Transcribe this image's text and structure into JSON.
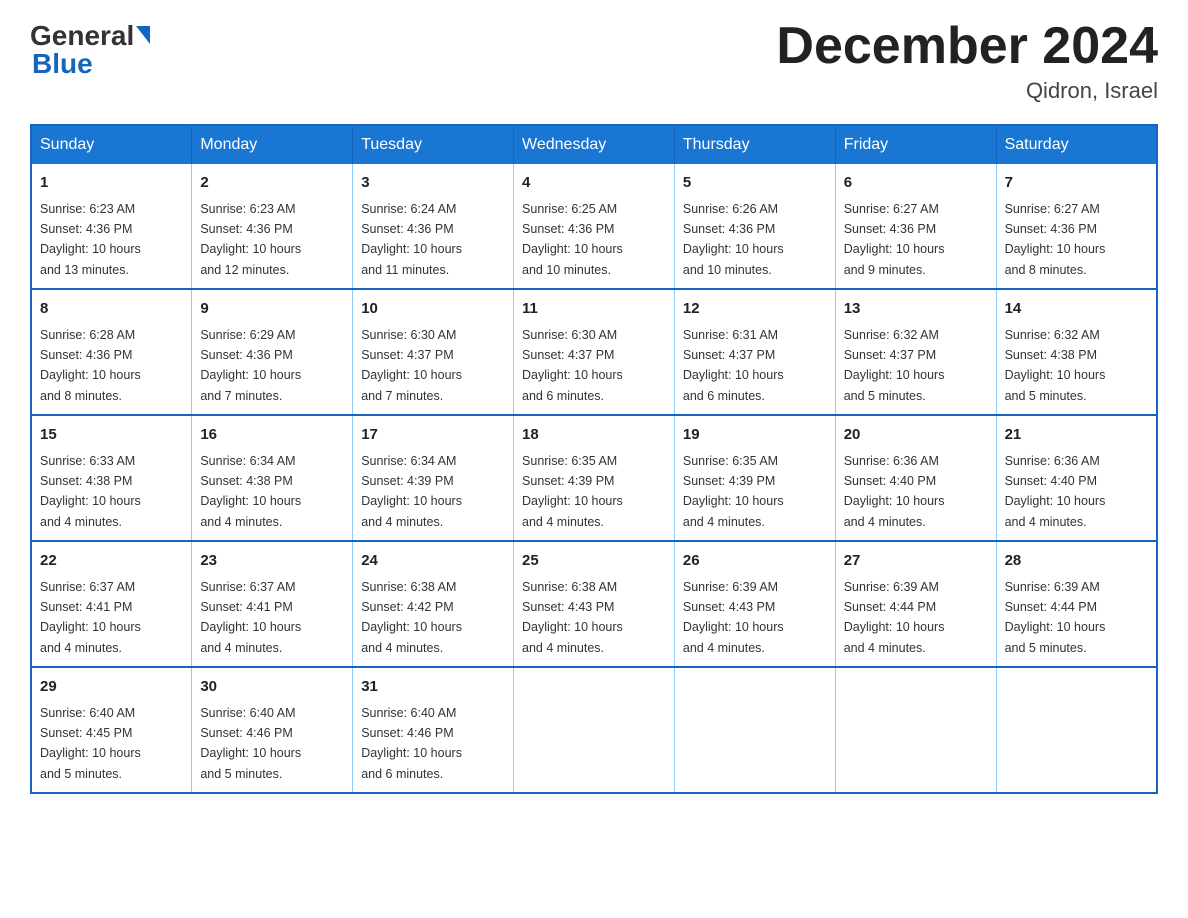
{
  "header": {
    "logo_general": "General",
    "logo_blue": "Blue",
    "month_title": "December 2024",
    "location": "Qidron, Israel"
  },
  "days_of_week": [
    "Sunday",
    "Monday",
    "Tuesday",
    "Wednesday",
    "Thursday",
    "Friday",
    "Saturday"
  ],
  "weeks": [
    [
      {
        "day": "1",
        "sunrise": "6:23 AM",
        "sunset": "4:36 PM",
        "daylight": "10 hours and 13 minutes."
      },
      {
        "day": "2",
        "sunrise": "6:23 AM",
        "sunset": "4:36 PM",
        "daylight": "10 hours and 12 minutes."
      },
      {
        "day": "3",
        "sunrise": "6:24 AM",
        "sunset": "4:36 PM",
        "daylight": "10 hours and 11 minutes."
      },
      {
        "day": "4",
        "sunrise": "6:25 AM",
        "sunset": "4:36 PM",
        "daylight": "10 hours and 10 minutes."
      },
      {
        "day": "5",
        "sunrise": "6:26 AM",
        "sunset": "4:36 PM",
        "daylight": "10 hours and 10 minutes."
      },
      {
        "day": "6",
        "sunrise": "6:27 AM",
        "sunset": "4:36 PM",
        "daylight": "10 hours and 9 minutes."
      },
      {
        "day": "7",
        "sunrise": "6:27 AM",
        "sunset": "4:36 PM",
        "daylight": "10 hours and 8 minutes."
      }
    ],
    [
      {
        "day": "8",
        "sunrise": "6:28 AM",
        "sunset": "4:36 PM",
        "daylight": "10 hours and 8 minutes."
      },
      {
        "day": "9",
        "sunrise": "6:29 AM",
        "sunset": "4:36 PM",
        "daylight": "10 hours and 7 minutes."
      },
      {
        "day": "10",
        "sunrise": "6:30 AM",
        "sunset": "4:37 PM",
        "daylight": "10 hours and 7 minutes."
      },
      {
        "day": "11",
        "sunrise": "6:30 AM",
        "sunset": "4:37 PM",
        "daylight": "10 hours and 6 minutes."
      },
      {
        "day": "12",
        "sunrise": "6:31 AM",
        "sunset": "4:37 PM",
        "daylight": "10 hours and 6 minutes."
      },
      {
        "day": "13",
        "sunrise": "6:32 AM",
        "sunset": "4:37 PM",
        "daylight": "10 hours and 5 minutes."
      },
      {
        "day": "14",
        "sunrise": "6:32 AM",
        "sunset": "4:38 PM",
        "daylight": "10 hours and 5 minutes."
      }
    ],
    [
      {
        "day": "15",
        "sunrise": "6:33 AM",
        "sunset": "4:38 PM",
        "daylight": "10 hours and 4 minutes."
      },
      {
        "day": "16",
        "sunrise": "6:34 AM",
        "sunset": "4:38 PM",
        "daylight": "10 hours and 4 minutes."
      },
      {
        "day": "17",
        "sunrise": "6:34 AM",
        "sunset": "4:39 PM",
        "daylight": "10 hours and 4 minutes."
      },
      {
        "day": "18",
        "sunrise": "6:35 AM",
        "sunset": "4:39 PM",
        "daylight": "10 hours and 4 minutes."
      },
      {
        "day": "19",
        "sunrise": "6:35 AM",
        "sunset": "4:39 PM",
        "daylight": "10 hours and 4 minutes."
      },
      {
        "day": "20",
        "sunrise": "6:36 AM",
        "sunset": "4:40 PM",
        "daylight": "10 hours and 4 minutes."
      },
      {
        "day": "21",
        "sunrise": "6:36 AM",
        "sunset": "4:40 PM",
        "daylight": "10 hours and 4 minutes."
      }
    ],
    [
      {
        "day": "22",
        "sunrise": "6:37 AM",
        "sunset": "4:41 PM",
        "daylight": "10 hours and 4 minutes."
      },
      {
        "day": "23",
        "sunrise": "6:37 AM",
        "sunset": "4:41 PM",
        "daylight": "10 hours and 4 minutes."
      },
      {
        "day": "24",
        "sunrise": "6:38 AM",
        "sunset": "4:42 PM",
        "daylight": "10 hours and 4 minutes."
      },
      {
        "day": "25",
        "sunrise": "6:38 AM",
        "sunset": "4:43 PM",
        "daylight": "10 hours and 4 minutes."
      },
      {
        "day": "26",
        "sunrise": "6:39 AM",
        "sunset": "4:43 PM",
        "daylight": "10 hours and 4 minutes."
      },
      {
        "day": "27",
        "sunrise": "6:39 AM",
        "sunset": "4:44 PM",
        "daylight": "10 hours and 4 minutes."
      },
      {
        "day": "28",
        "sunrise": "6:39 AM",
        "sunset": "4:44 PM",
        "daylight": "10 hours and 5 minutes."
      }
    ],
    [
      {
        "day": "29",
        "sunrise": "6:40 AM",
        "sunset": "4:45 PM",
        "daylight": "10 hours and 5 minutes."
      },
      {
        "day": "30",
        "sunrise": "6:40 AM",
        "sunset": "4:46 PM",
        "daylight": "10 hours and 5 minutes."
      },
      {
        "day": "31",
        "sunrise": "6:40 AM",
        "sunset": "4:46 PM",
        "daylight": "10 hours and 6 minutes."
      },
      null,
      null,
      null,
      null
    ]
  ],
  "labels": {
    "sunrise": "Sunrise:",
    "sunset": "Sunset:",
    "daylight": "Daylight:"
  }
}
